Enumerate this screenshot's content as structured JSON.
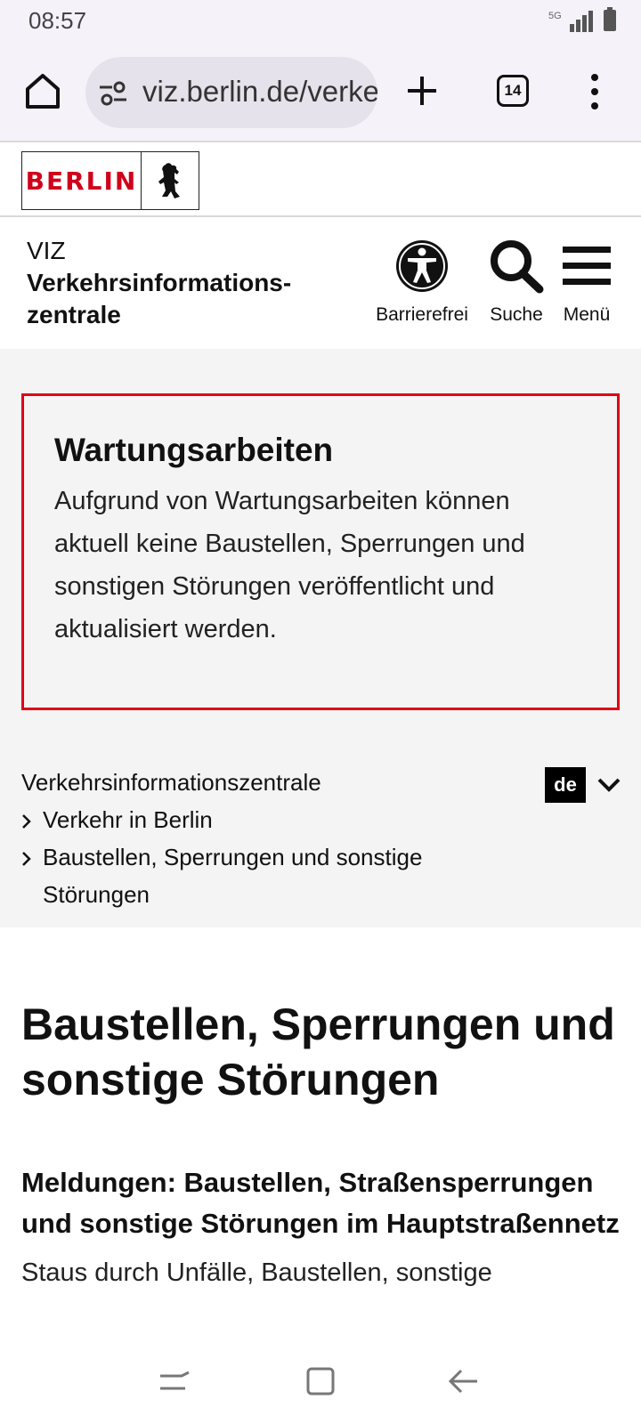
{
  "status": {
    "time": "08:57",
    "network": "5G"
  },
  "browser": {
    "url": "viz.berlin.de/verke",
    "tab_count": "14"
  },
  "logo": {
    "text": "BERLIN"
  },
  "header": {
    "viz": "VIZ",
    "name_line1": "Verkehrsinformations-",
    "name_line2": "zentrale",
    "access_label": "Barrierefrei",
    "search_label": "Suche",
    "menu_label": "Menü"
  },
  "notice": {
    "title": "Wartungsarbeiten",
    "text": "Aufgrund von Wartungsarbeiten können aktuell keine Baustellen, Sperrungen und sonstigen Störungen veröffentlicht und aktualisiert werden."
  },
  "breadcrumb": {
    "root": "Verkehrsinformationszentrale",
    "level1": "Verkehr in Berlin",
    "level2": "Baustellen, Sperrungen und sonstige Störungen"
  },
  "language": {
    "current": "de"
  },
  "content": {
    "title": "Baustellen, Sperrungen und sonstige Störungen",
    "subtitle": "Meldungen: Baustellen, Straßensperrungen und sonstige Störungen im Hauptstraßennetz",
    "intro": "Staus durch Unfälle, Baustellen, sonstige"
  },
  "colors": {
    "accent_red": "#e0001a",
    "logo_red": "#d0021b"
  }
}
